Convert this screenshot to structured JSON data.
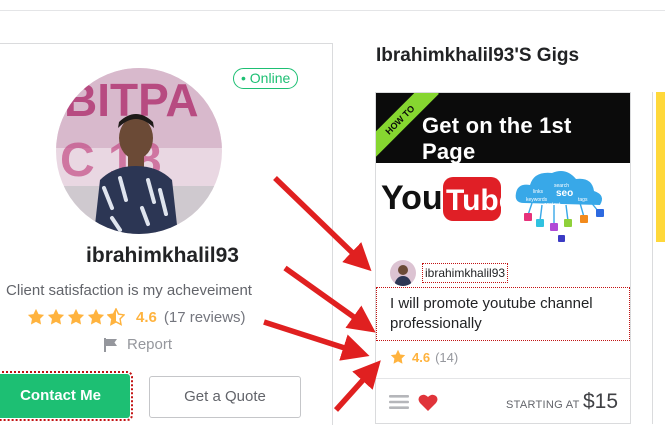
{
  "profile": {
    "online_label": "• Online",
    "avatar_overlay_text": "BITPA C018",
    "username": "ibrahimkhalil93",
    "tagline": "Client satisfaction is my acheveiment",
    "rating": 4.5,
    "rating_label": "4.6",
    "reviews_label": "(17 reviews)",
    "report_label": "Report",
    "contact_label": "Contact Me",
    "quote_label": "Get a Quote"
  },
  "gigs": {
    "title": "Ibrahimkhalil93'S Gigs",
    "items": [
      {
        "thumb_banner_text": "Get on the 1st Page",
        "thumb_ribbon_text": "HOW TO",
        "thumb_logo_text": "YouTube",
        "thumb_cloud_labels": [
          "search",
          "seo",
          "links",
          "keywords",
          "tags",
          "content"
        ],
        "seller": "ibrahimkhalil93",
        "description": "I will promote youtube channel professionally",
        "rating_label": "4.6",
        "reviews_label": "(14)",
        "starting_label": "STARTING AT",
        "price": "$15"
      }
    ]
  },
  "colors": {
    "accent_green": "#1dbf73",
    "star_yellow": "#ffb33e",
    "annotation_red": "#e02020",
    "heart_red": "#e0343a"
  },
  "icons": [
    "star-icon",
    "flag-icon",
    "menu-icon",
    "heart-icon",
    "annotation-arrow"
  ]
}
